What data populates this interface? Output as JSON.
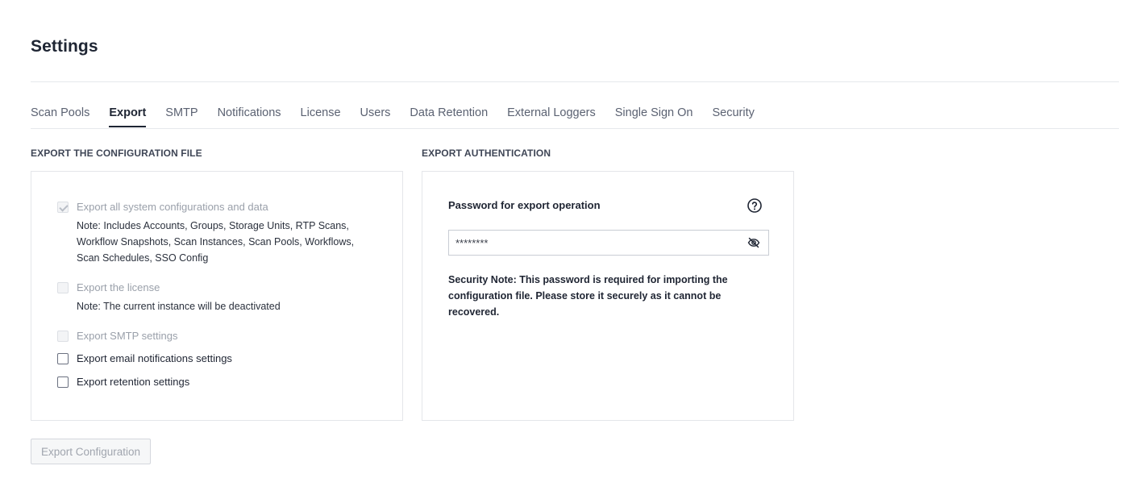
{
  "header": {
    "title": "Settings"
  },
  "tabs": [
    {
      "label": "Scan Pools",
      "active": false
    },
    {
      "label": "Export",
      "active": true
    },
    {
      "label": "SMTP",
      "active": false
    },
    {
      "label": "Notifications",
      "active": false
    },
    {
      "label": "License",
      "active": false
    },
    {
      "label": "Users",
      "active": false
    },
    {
      "label": "Data Retention",
      "active": false
    },
    {
      "label": "External Loggers",
      "active": false
    },
    {
      "label": "Single Sign On",
      "active": false
    },
    {
      "label": "Security",
      "active": false
    }
  ],
  "export_config": {
    "section_label": "EXPORT THE CONFIGURATION FILE",
    "options": [
      {
        "label": "Export all system configurations and data",
        "checked": true,
        "disabled": true
      },
      {
        "label": "Export the license",
        "checked": false,
        "disabled": true
      },
      {
        "label": "Export SMTP settings",
        "checked": false,
        "disabled": true
      },
      {
        "label": "Export email notifications settings",
        "checked": false,
        "disabled": false
      },
      {
        "label": "Export retention settings",
        "checked": false,
        "disabled": false
      }
    ],
    "notes": {
      "all_data_line1": "Note: Includes Accounts, Groups, Storage Units, RTP Scans,",
      "all_data_line2": "Workflow Snapshots, Scan Instances, Scan Pools, Workflows,",
      "all_data_line3": "Scan Schedules, SSO Config",
      "license": "Note: The current instance will be deactivated"
    }
  },
  "export_auth": {
    "section_label": "EXPORT AUTHENTICATION",
    "password_label": "Password for export operation",
    "password_value": "********",
    "security_note_line1": "Security Note: This password is required for importing the",
    "security_note_line2": "configuration file. Please store it securely as it cannot be recovered."
  },
  "actions": {
    "export_button": "Export Configuration"
  },
  "icons": {
    "help": "question-circle-icon",
    "visibility": "eye-off-icon"
  },
  "colors": {
    "text_primary": "#1e2533",
    "text_muted": "#5b6272",
    "border": "#e4e6ea",
    "disabled_text": "#9aa0aa"
  }
}
